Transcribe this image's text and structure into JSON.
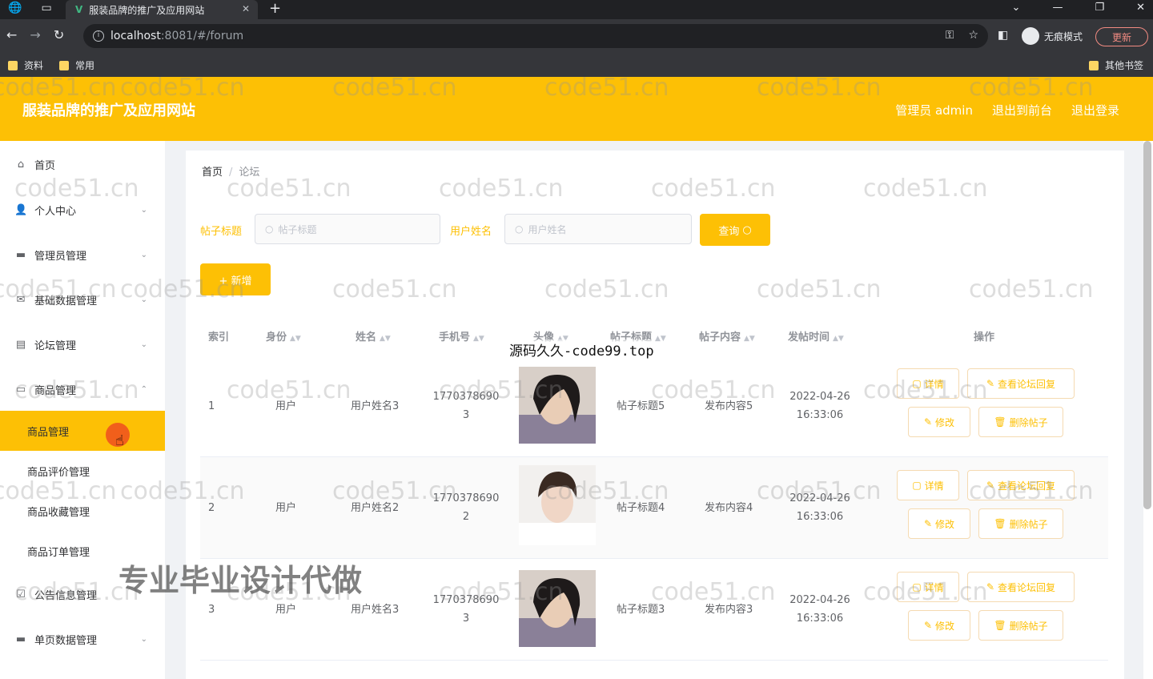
{
  "browser": {
    "tab_title": "服装品牌的推广及应用网站",
    "url_host": "localhost",
    "url_rest": ":8081/#/forum",
    "profile_label": "无痕模式",
    "update_label": "更新",
    "bookmarks": [
      "资料",
      "常用"
    ],
    "other_bookmarks": "其他书签"
  },
  "header": {
    "title": "服装品牌的推广及应用网站",
    "admin_label": "管理员 admin",
    "back_front": "退出到前台",
    "logout": "退出登录"
  },
  "sidebar": {
    "items": [
      {
        "label": "首页",
        "icon": "home-icon",
        "has_children": false
      },
      {
        "label": "个人中心",
        "icon": "user-icon",
        "has_children": true
      },
      {
        "label": "管理员管理",
        "icon": "briefcase-icon",
        "has_children": true
      },
      {
        "label": "基础数据管理",
        "icon": "mail-icon",
        "has_children": true
      },
      {
        "label": "论坛管理",
        "icon": "document-icon",
        "has_children": true
      },
      {
        "label": "商品管理",
        "icon": "box-icon",
        "has_children": true
      }
    ],
    "subitems": [
      {
        "label": "商品管理",
        "active": true
      },
      {
        "label": "商品评价管理",
        "active": false
      },
      {
        "label": "商品收藏管理",
        "active": false
      },
      {
        "label": "商品订单管理",
        "active": false
      }
    ],
    "items_after": [
      {
        "label": "公告信息管理",
        "icon": "checklist-icon",
        "has_children": true
      },
      {
        "label": "单页数据管理",
        "icon": "monitor-icon",
        "has_children": true
      }
    ]
  },
  "breadcrumb": {
    "home": "首页",
    "current": "论坛"
  },
  "search": {
    "title_label": "帖子标题",
    "title_placeholder": "帖子标题",
    "user_label": "用户姓名",
    "user_placeholder": "用户姓名",
    "query_label": "查询",
    "add_label": "+ 新增"
  },
  "table": {
    "columns": [
      "索引",
      "身份",
      "姓名",
      "手机号",
      "头像",
      "帖子标题",
      "帖子内容",
      "发帖时间",
      "操作"
    ],
    "rows": [
      {
        "index": "1",
        "role": "用户",
        "name": "用户姓名3",
        "phone_a": "1770378690",
        "phone_b": "3",
        "title": "帖子标题5",
        "content": "发布内容5",
        "date": "2022-04-26",
        "time": "16:33:06"
      },
      {
        "index": "2",
        "role": "用户",
        "name": "用户姓名2",
        "phone_a": "1770378690",
        "phone_b": "2",
        "title": "帖子标题4",
        "content": "发布内容4",
        "date": "2022-04-26",
        "time": "16:33:06"
      },
      {
        "index": "3",
        "role": "用户",
        "name": "用户姓名3",
        "phone_a": "1770378690",
        "phone_b": "3",
        "title": "帖子标题3",
        "content": "发布内容3",
        "date": "2022-04-26",
        "time": "16:33:06"
      }
    ],
    "actions": {
      "detail": "详情",
      "view_replies": "查看论坛回复",
      "edit": "修改",
      "delete": "删除帖子"
    }
  },
  "overlays": {
    "watermark": "code51.cn",
    "banner": "源码久久-code99.top",
    "promo": "专业毕业设计代做"
  },
  "colors": {
    "accent": "#fdc005",
    "chrome_dark": "#202124"
  }
}
